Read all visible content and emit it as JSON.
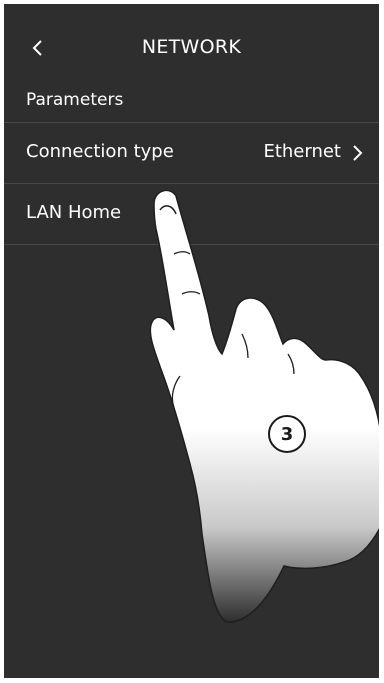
{
  "header": {
    "back_icon": "chevron-left-icon",
    "title": "NETWORK"
  },
  "section": {
    "label": "Parameters"
  },
  "rows": [
    {
      "label": "Connection type",
      "value": "Ethernet",
      "icon": "chevron-right-icon"
    },
    {
      "label": "LAN Home"
    }
  ],
  "overlay": {
    "step_number": "3",
    "gesture_icon": "pointing-hand-icon"
  },
  "colors": {
    "background": "#2e2e2e",
    "text": "#ffffff",
    "divider": "#4a4a4a"
  }
}
